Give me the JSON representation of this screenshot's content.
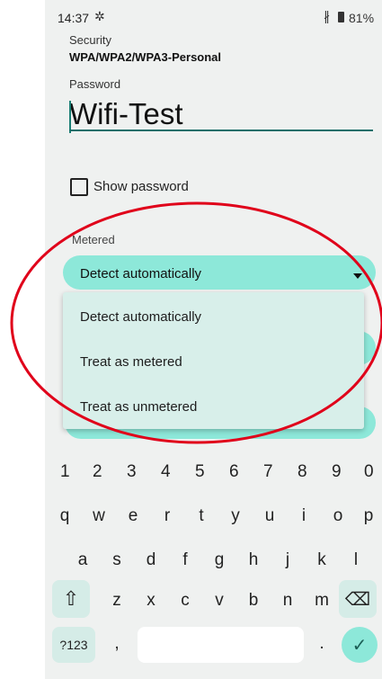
{
  "status_bar": {
    "time": "14:37",
    "battery": "81%"
  },
  "security": {
    "label": "Security",
    "value": "WPA/WPA2/WPA3-Personal"
  },
  "password": {
    "label": "Password",
    "value": "Wifi-Test"
  },
  "show_password": {
    "label": "Show password",
    "checked": false
  },
  "metered": {
    "label": "Metered",
    "selected": "Detect automatically",
    "options": [
      "Detect automatically",
      "Treat as metered",
      "Treat as unmetered"
    ]
  },
  "keyboard": {
    "numbers": [
      "1",
      "2",
      "3",
      "4",
      "5",
      "6",
      "7",
      "8",
      "9",
      "0"
    ],
    "row1": [
      "q",
      "w",
      "e",
      "r",
      "t",
      "y",
      "u",
      "i",
      "o",
      "p"
    ],
    "row2": [
      "a",
      "s",
      "d",
      "f",
      "g",
      "h",
      "j",
      "k",
      "l"
    ],
    "row3": [
      "z",
      "x",
      "c",
      "v",
      "b",
      "n",
      "m"
    ],
    "symbols_key": "?123",
    "comma_key": ",",
    "period_key": "."
  },
  "colors": {
    "accent": "#8de8d9",
    "annotation": "#e0001a"
  }
}
